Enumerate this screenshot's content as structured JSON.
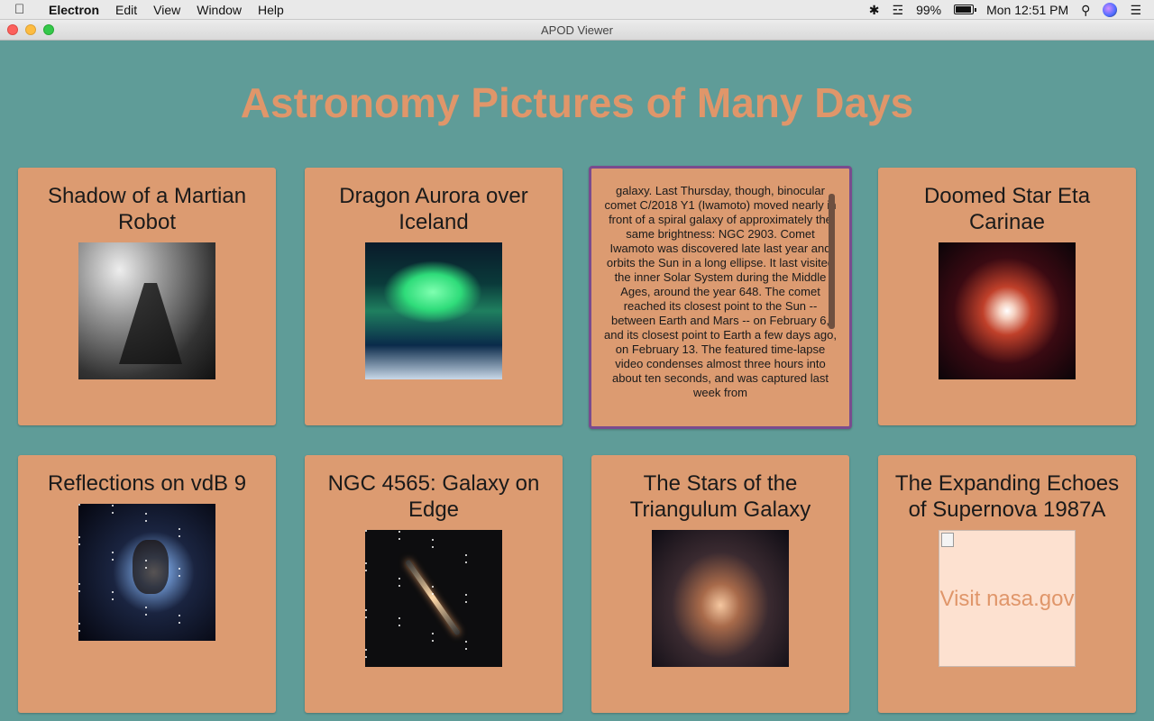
{
  "menubar": {
    "app_name": "Electron",
    "menus": [
      "Edit",
      "View",
      "Window",
      "Help"
    ],
    "battery_percent": "99%",
    "clock": "Mon 12:51 PM",
    "battery_level": 0.99
  },
  "window": {
    "title": "APOD Viewer"
  },
  "page": {
    "heading": "Astronomy Pictures of Many Days"
  },
  "cards": [
    {
      "title": "Shadow of a Martian Robot",
      "image": "martian-robot-shadow"
    },
    {
      "title": "Dragon Aurora over Iceland",
      "image": "dragon-aurora"
    },
    {
      "description": "galaxy. Last Thursday, though, binocular comet C/2018 Y1 (Iwamoto) moved nearly in front of a spiral galaxy of approximately the same brightness: NGC 2903. Comet Iwamoto was discovered late last year and orbits the Sun in a long ellipse. It last visited the inner Solar System during the Middle Ages, around the year 648. The comet reached its closest point to the Sun -- between Earth and Mars -- on February 6, and its closest point to Earth a few days ago, on February 13. The featured time-lapse video condenses almost three hours into about ten seconds, and was captured last week from"
    },
    {
      "title": "Doomed Star Eta Carinae",
      "image": "eta-carinae"
    },
    {
      "title": "Reflections on vdB 9",
      "image": "vdb-9"
    },
    {
      "title": "NGC 4565: Galaxy on Edge",
      "image": "ngc-4565"
    },
    {
      "title": "The Stars of the Triangulum Galaxy",
      "image": "triangulum-galaxy"
    },
    {
      "title": "The Expanding Echoes of Supernova 1987A",
      "image_alt": "Visit nasa.gov"
    }
  ],
  "colors": {
    "background": "#5f9c98",
    "card": "#dc9b71",
    "heading": "#e0966a",
    "focus_border": "#7a4b8e"
  }
}
